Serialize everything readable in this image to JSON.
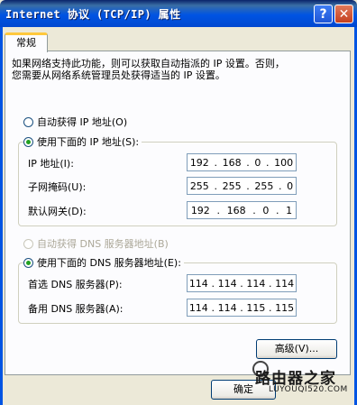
{
  "window": {
    "title": "Internet 协议 (TCP/IP) 属性",
    "help_label": "?",
    "close_label": "✕"
  },
  "tabs": [
    {
      "label": "常规"
    }
  ],
  "description": [
    "如果网络支持此功能，则可以获取自动指派的 IP 设置。否则，",
    "您需要从网络系统管理员处获得适当的 IP 设置。"
  ],
  "ip_section": {
    "auto_label": "自动获得 IP 地址(O)",
    "auto_selected": false,
    "manual_label": "使用下面的 IP 地址(S):",
    "manual_selected": true,
    "fields": [
      {
        "label": "IP 地址(I):",
        "octets": [
          "192",
          "168",
          "0",
          "100"
        ]
      },
      {
        "label": "子网掩码(U):",
        "octets": [
          "255",
          "255",
          "255",
          "0"
        ]
      },
      {
        "label": "默认网关(D):",
        "octets": [
          "192",
          "168",
          "0",
          "1"
        ]
      }
    ]
  },
  "dns_section": {
    "auto_label": "自动获得 DNS 服务器地址(B)",
    "auto_selected": false,
    "auto_disabled": true,
    "manual_label": "使用下面的 DNS 服务器地址(E):",
    "manual_selected": true,
    "fields": [
      {
        "label": "首选 DNS 服务器(P):",
        "octets": [
          "114",
          "114",
          "114",
          "114"
        ]
      },
      {
        "label": "备用 DNS 服务器(A):",
        "octets": [
          "114",
          "114",
          "115",
          "115"
        ]
      }
    ]
  },
  "buttons": {
    "advanced_label": "高级(V)...",
    "ok_label": "确定"
  },
  "watermark": {
    "text": "路由器之家",
    "url": "LUYOUQI520.COM"
  },
  "colors": {
    "titlebar": "#0054e3",
    "tab_highlight": "#ffc83c",
    "radio_dot": "#21a121"
  }
}
